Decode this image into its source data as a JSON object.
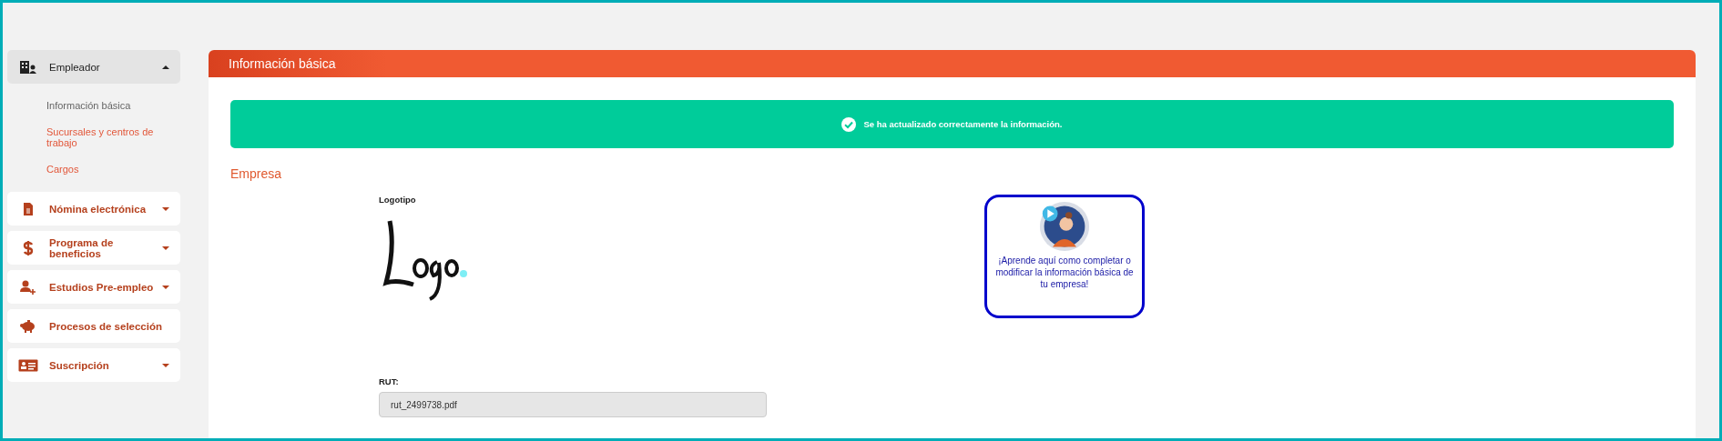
{
  "sidebar": {
    "items": [
      {
        "label": "Empleador",
        "expandable": true,
        "expanded": true,
        "children": [
          {
            "label": "Información básica",
            "selected": true
          },
          {
            "label": "Sucursales y centros de trabajo",
            "selected": false
          },
          {
            "label": "Cargos",
            "selected": false
          }
        ]
      },
      {
        "label": "Nómina electrónica",
        "expandable": true,
        "expanded": false
      },
      {
        "label": "Programa de beneficios",
        "expandable": true,
        "expanded": false
      },
      {
        "label": "Estudios Pre-empleo",
        "expandable": true,
        "expanded": false
      },
      {
        "label": "Procesos de selección",
        "expandable": false,
        "expanded": false
      },
      {
        "label": "Suscripción",
        "expandable": true,
        "expanded": false
      }
    ]
  },
  "panel": {
    "title": "Información básica",
    "alert": {
      "kind": "success",
      "message": "Se ha actualizado correctamente la información."
    },
    "section_title": "Empresa",
    "logo": {
      "label": "Logotipo",
      "kind": "picture"
    },
    "video_card": {
      "kind": "picture",
      "text": "¡Aprende aquí como completar o modificar la información básica de tu empresa!"
    },
    "rut": {
      "label": "RUT:",
      "value": "rut_2499738.pdf"
    }
  }
}
